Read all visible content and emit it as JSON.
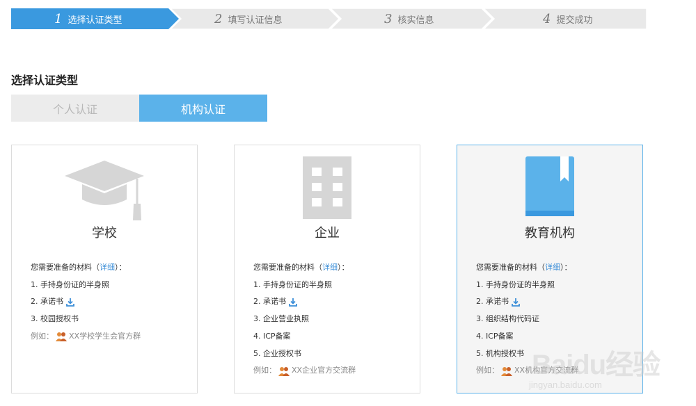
{
  "steps": [
    {
      "num": "1",
      "label": "选择认证类型",
      "active": true
    },
    {
      "num": "2",
      "label": "填写认证信息",
      "active": false
    },
    {
      "num": "3",
      "label": "核实信息",
      "active": false
    },
    {
      "num": "4",
      "label": "提交成功",
      "active": false
    }
  ],
  "section_title": "选择认证类型",
  "tabs": {
    "personal": "个人认证",
    "organization": "机构认证",
    "selected": "organization"
  },
  "materials_prefix": "您需要准备的材料（",
  "materials_detail": "详细",
  "materials_suffix": "）：",
  "example_prefix": "例如：",
  "cards": [
    {
      "title": "学校",
      "icon": "graduation-cap-icon",
      "items": [
        "1. 手持身份证的半身照",
        "2. 承诺书",
        "3. 校园授权书"
      ],
      "example": "XX学校学生会官方群",
      "selected": false
    },
    {
      "title": "企业",
      "icon": "building-icon",
      "items": [
        "1. 手持身份证的半身照",
        "2. 承诺书",
        "3. 企业营业执照",
        "4. ICP备案",
        "5. 企业授权书"
      ],
      "example": "XX企业官方交流群",
      "selected": false
    },
    {
      "title": "教育机构",
      "icon": "book-icon",
      "items": [
        "1. 手持身份证的半身照",
        "2. 承诺书",
        "3. 组织结构代码证",
        "4. ICP备案",
        "5. 机构授权书"
      ],
      "example": "XX机构官方交流群",
      "selected": true
    }
  ],
  "watermark": {
    "brand": "Baidu经验",
    "url": "jingyan.baidu.com"
  },
  "colors": {
    "accent": "#5bb2ea",
    "link": "#3d8fd8",
    "step_inactive": "#e9e9e9",
    "icon_gray": "#d6d6d6"
  }
}
